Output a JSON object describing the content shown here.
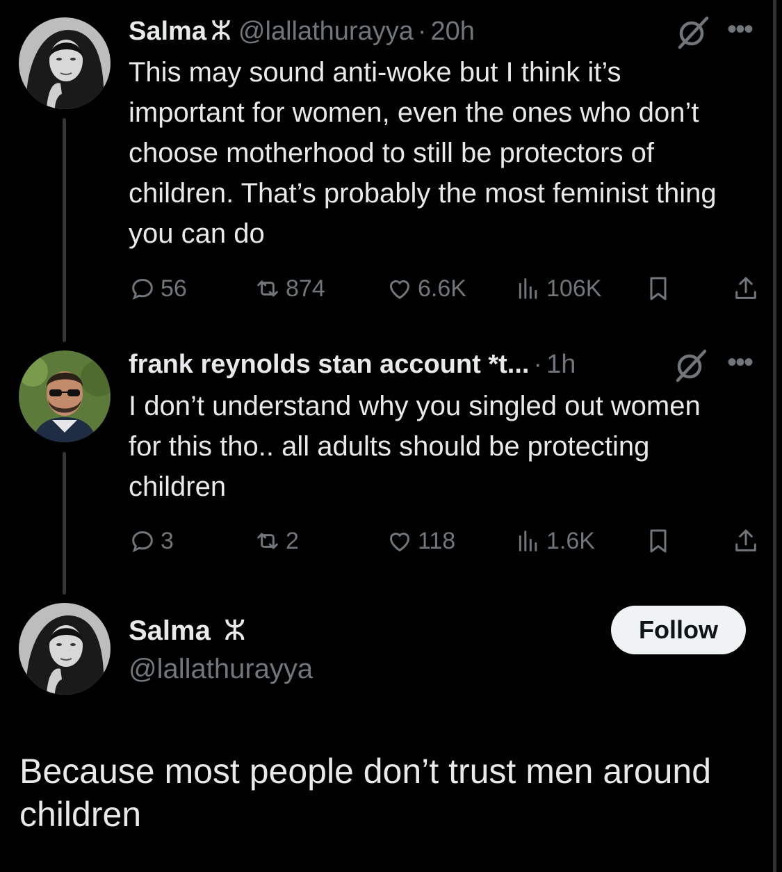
{
  "tweet1": {
    "name": "Salma",
    "badge": "ⵣ",
    "handle": "@lallathurayya",
    "separator": "·",
    "time": "20h",
    "text": "This may sound anti-woke but I think it’s important for women, even the ones who don’t choose motherhood to still be protectors of children. That’s probably the most feminist thing you can do",
    "replies": "56",
    "reposts": "874",
    "likes": "6.6K",
    "views": "106K"
  },
  "tweet2": {
    "name": "frank reynolds stan account *t...",
    "separator": "·",
    "time": "1h",
    "text": "I don’t understand why you singled out women for this tho.. all adults should be protecting children",
    "replies": "3",
    "reposts": "2",
    "likes": "118",
    "views": "1.6K"
  },
  "main_tweet": {
    "name": "Salma",
    "badge": "ⵣ",
    "handle": "@lallathurayya",
    "follow_label": "Follow",
    "text": "Because most people don’t trust men around children"
  },
  "icons": {
    "grok": "grok-icon",
    "more": "more-icon",
    "reply": "reply-icon",
    "repost": "repost-icon",
    "like": "like-icon",
    "views": "views-icon",
    "bookmark": "bookmark-icon",
    "share": "share-icon"
  },
  "colors": {
    "background": "#000000",
    "text": "#e7e9ea",
    "secondary": "#71767b",
    "thread_line": "#333639",
    "follow_bg": "#eff3f4"
  }
}
